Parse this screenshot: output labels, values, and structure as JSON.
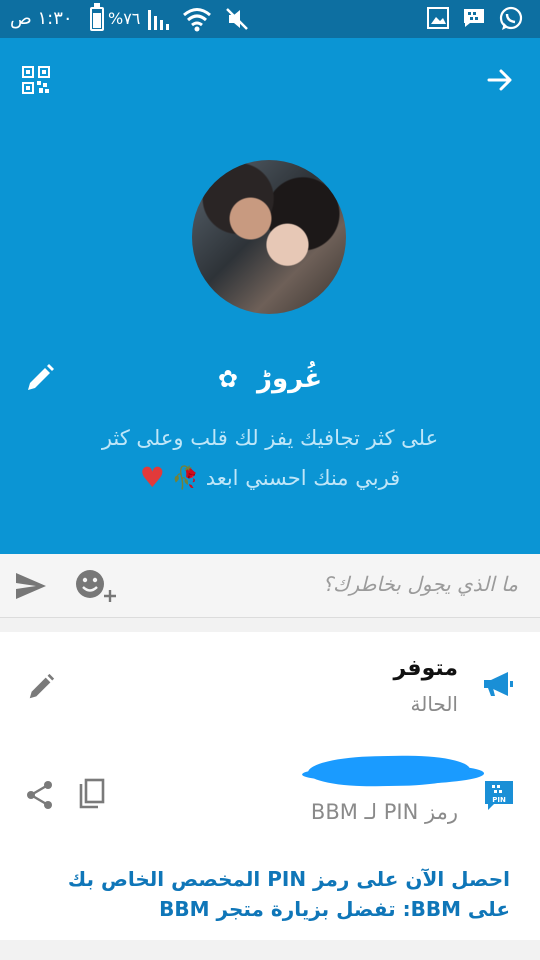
{
  "status_bar": {
    "time": "١:٣٠ ص",
    "battery_percent": "%٧٦",
    "battery_level": 0.76,
    "icons": [
      "battery-icon",
      "signal-icon",
      "wifi-icon",
      "mute-icon",
      "whatsapp-icon",
      "bbm-notification-icon",
      "gallery-icon"
    ]
  },
  "profile": {
    "display_name": "غُروڑ",
    "name_decoration": "✿",
    "bio_line1": "على كثر تجافيك يفز لك قلب وعلى كثر",
    "bio_line2": "قربي منك احسني ابعد",
    "bio_emoji_rose": "🥀",
    "bio_emoji_heart": "♥",
    "qr_icon": "qr-code-icon",
    "forward_icon": "arrow-right-icon",
    "edit_icon": "pencil-icon"
  },
  "status_input": {
    "placeholder": "ما الذي يجول بخاطرك؟",
    "send_icon": "send-icon",
    "emoji_icon": "add-emoji-icon"
  },
  "details": {
    "availability_title": "متوفر",
    "availability_subtitle": "الحالة",
    "pin_label": "رمز PIN لـ BBM",
    "promo_text": "احصل الآن على رمز PIN المخصص الخاص بك على BBM: تفضل بزيارة متجر BBM",
    "pin_badge_text": "PIN"
  },
  "colors": {
    "status_bar": "#0d6fa1",
    "profile_bg": "#0b95d4",
    "accent_blue": "#0f76b8",
    "redaction": "#1a9bff"
  }
}
